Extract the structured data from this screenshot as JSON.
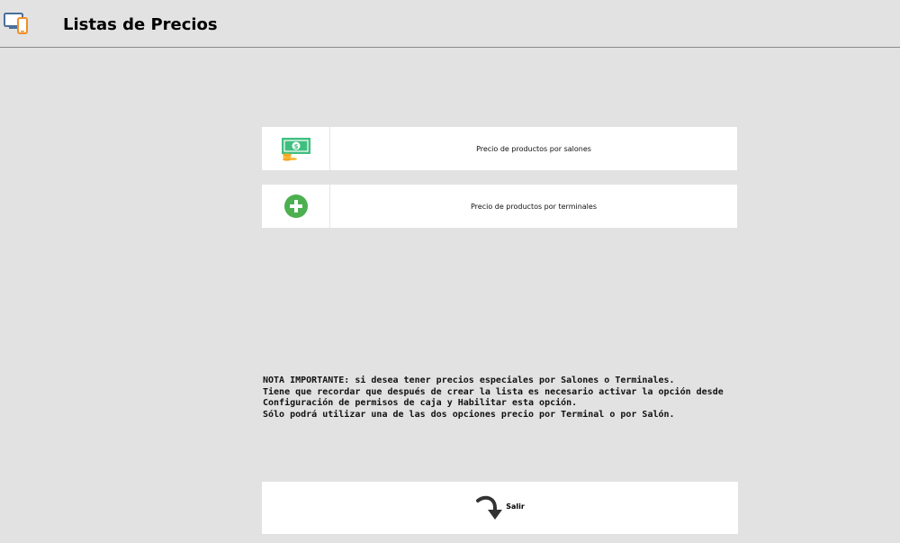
{
  "header": {
    "title": "Listas de Precios",
    "icon": "devices-icon"
  },
  "options": [
    {
      "label": "Precio de productos por salones",
      "icon": "money-coins-icon"
    },
    {
      "label": "Precio de productos por terminales",
      "icon": "plus-circle-icon"
    }
  ],
  "note": {
    "lines": [
      "NOTA IMPORTANTE: si desea tener precios especiales por Salones o Terminales.",
      "Tiene que recordar que después de crear la lista es necesario activar la opción desde",
      "Configuración de permisos de caja y Habilitar esta opción.",
      "Sólo podrá utilizar una de las dos opciones precio por Terminal o por Salón."
    ]
  },
  "exit": {
    "label": "Salir",
    "icon": "curved-arrow-down-icon"
  },
  "colors": {
    "background": "#e2e2e2",
    "card": "#ffffff",
    "green": "#4caf50",
    "orange": "#f28c28",
    "blue": "#4a90d9"
  }
}
